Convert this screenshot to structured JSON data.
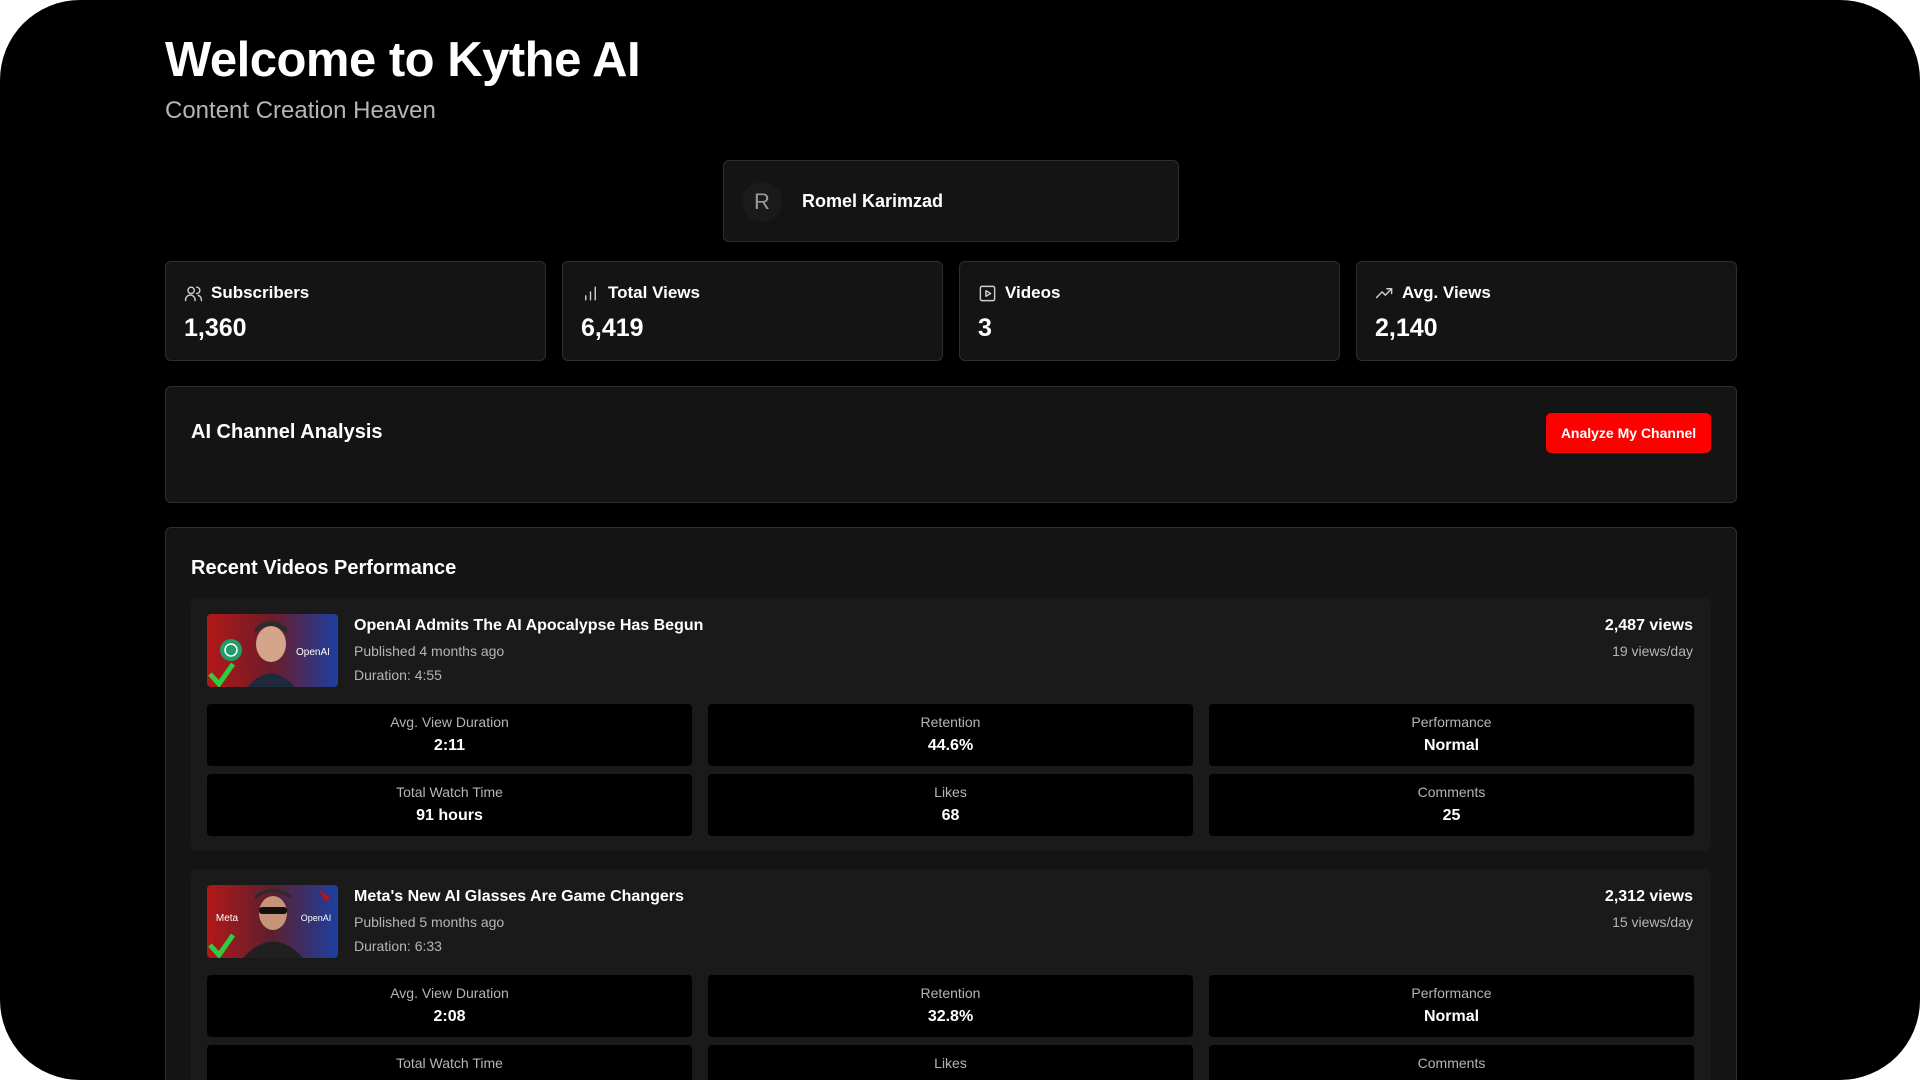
{
  "header": {
    "title": "Welcome to Kythe AI",
    "subtitle": "Content Creation Heaven"
  },
  "channel": {
    "avatar_initial": "R",
    "name": "Romel Karimzad"
  },
  "stats": [
    {
      "label": "Subscribers",
      "value": "1,360",
      "icon": "users-icon"
    },
    {
      "label": "Total Views",
      "value": "6,419",
      "icon": "bar-chart-icon"
    },
    {
      "label": "Videos",
      "value": "3",
      "icon": "play-square-icon"
    },
    {
      "label": "Avg. Views",
      "value": "2,140",
      "icon": "trending-up-icon"
    }
  ],
  "analysis": {
    "title": "AI Channel Analysis",
    "button_label": "Analyze My Channel"
  },
  "recent": {
    "title": "Recent Videos Performance",
    "videos": [
      {
        "title": "OpenAI Admits The AI Apocalypse Has Begun",
        "published": "Published 4 months ago",
        "duration": "Duration: 4:55",
        "views": "2,487 views",
        "views_per_day": "19 views/day",
        "thumb_text": "OpenAI",
        "metrics": [
          {
            "label": "Avg. View Duration",
            "value": "2:11"
          },
          {
            "label": "Retention",
            "value": "44.6%"
          },
          {
            "label": "Performance",
            "value": "Normal"
          },
          {
            "label": "Total Watch Time",
            "value": "91 hours"
          },
          {
            "label": "Likes",
            "value": "68"
          },
          {
            "label": "Comments",
            "value": "25"
          }
        ]
      },
      {
        "title": "Meta's New AI Glasses Are Game Changers",
        "published": "Published 5 months ago",
        "duration": "Duration: 6:33",
        "views": "2,312 views",
        "views_per_day": "15 views/day",
        "thumb_text_left": "Meta",
        "thumb_text_right": "OpenAI",
        "metrics": [
          {
            "label": "Avg. View Duration",
            "value": "2:08"
          },
          {
            "label": "Retention",
            "value": "32.8%"
          },
          {
            "label": "Performance",
            "value": "Normal"
          },
          {
            "label": "Total Watch Time",
            "value": ""
          },
          {
            "label": "Likes",
            "value": ""
          },
          {
            "label": "Comments",
            "value": ""
          }
        ]
      }
    ]
  },
  "colors": {
    "background": "#000000",
    "card": "#141414",
    "accent": "#ff0000"
  }
}
